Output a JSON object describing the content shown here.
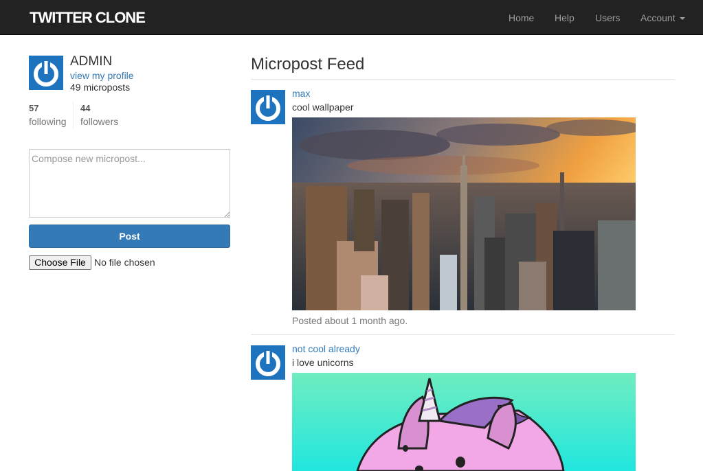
{
  "navbar": {
    "brand": "TWITTER CLONE",
    "links": [
      "Home",
      "Help",
      "Users",
      "Account"
    ]
  },
  "sidebar": {
    "user_name": "ADMIN",
    "profile_link": "view my profile",
    "micropost_count": "49 microposts",
    "stats": {
      "following_count": "57",
      "following_label": "following",
      "followers_count": "44",
      "followers_label": "followers"
    },
    "compose": {
      "placeholder": "Compose new micropost...",
      "value": ""
    },
    "post_button": "Post",
    "file_button": "Choose File",
    "file_status": "No file chosen"
  },
  "feed": {
    "title": "Micropost Feed",
    "posts": [
      {
        "user": "max",
        "content": "cool wallpaper",
        "image": "city-skyline-image",
        "timestamp": "Posted about 1 month ago."
      },
      {
        "user": "not cool already",
        "content": "i love unicorns",
        "image": "cartoon-unicorn-image",
        "timestamp": ""
      }
    ]
  },
  "colors": {
    "navbar_bg": "#222222",
    "link": "#337ab7",
    "primary_button": "#337ab7",
    "gravatar": "#1e73be"
  },
  "icons": [
    "gravatar-power-icon",
    "caret-down-icon"
  ]
}
